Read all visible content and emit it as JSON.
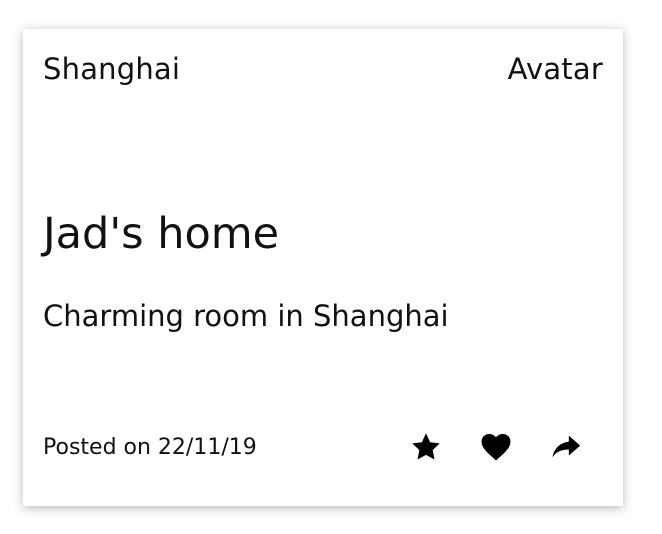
{
  "card": {
    "location": "Shanghai",
    "avatar_label": "Avatar",
    "title": "Jad's home",
    "subtitle": "Charming room in Shanghai",
    "posted": "Posted on 22/11/19",
    "actions": [
      {
        "icon": "star-icon"
      },
      {
        "icon": "heart-icon"
      },
      {
        "icon": "share-icon"
      }
    ]
  },
  "colors": {
    "text": "#111111",
    "icon": "#000000",
    "background": "#ffffff"
  }
}
